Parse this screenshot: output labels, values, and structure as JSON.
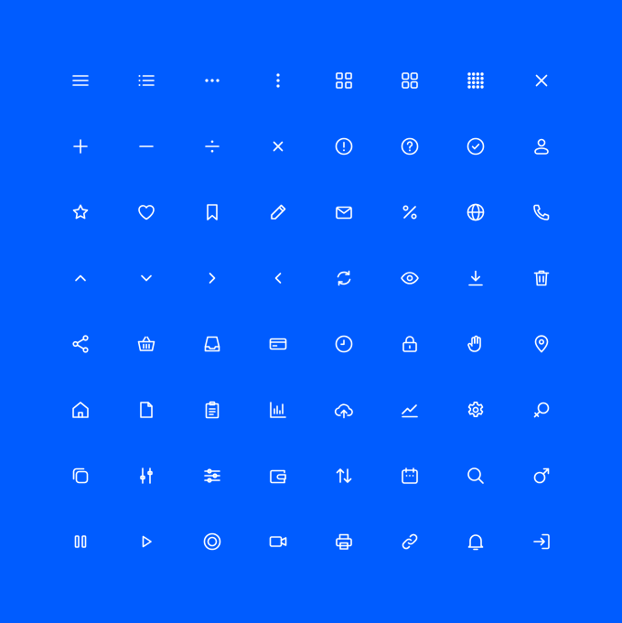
{
  "background": "#005CFF",
  "icon_color": "#FFFFFF",
  "icons": [
    [
      "hamburger-menu-icon",
      "bullet-list-icon",
      "horizontal-dots-icon",
      "vertical-dots-icon",
      "grid-four-rounded-icon",
      "grid-four-square-icon",
      "grid-dots-icon",
      "close-icon"
    ],
    [
      "plus-icon",
      "minus-icon",
      "divide-icon",
      "multiply-icon",
      "alert-circle-icon",
      "help-circle-icon",
      "check-circle-icon",
      "user-icon"
    ],
    [
      "star-icon",
      "heart-icon",
      "bookmark-icon",
      "pencil-icon",
      "mail-icon",
      "percent-icon",
      "globe-icon",
      "phone-icon"
    ],
    [
      "chevron-up-icon",
      "chevron-down-icon",
      "chevron-right-icon",
      "chevron-left-icon",
      "refresh-icon",
      "eye-icon",
      "download-icon",
      "trash-icon"
    ],
    [
      "share-icon",
      "basket-icon",
      "inbox-icon",
      "credit-card-icon",
      "clock-icon",
      "lock-icon",
      "hand-icon",
      "map-pin-icon"
    ],
    [
      "home-icon",
      "file-icon",
      "clipboard-icon",
      "bar-chart-icon",
      "cloud-upload-icon",
      "trend-chart-icon",
      "settings-icon",
      "female-icon"
    ],
    [
      "copy-icon",
      "sliders-vertical-icon",
      "sliders-horizontal-icon",
      "wallet-icon",
      "sort-arrows-icon",
      "calendar-icon",
      "search-icon",
      "male-icon"
    ],
    [
      "pause-icon",
      "play-icon",
      "record-icon",
      "video-camera-icon",
      "printer-icon",
      "link-icon",
      "bell-icon",
      "log-in-icon"
    ]
  ]
}
